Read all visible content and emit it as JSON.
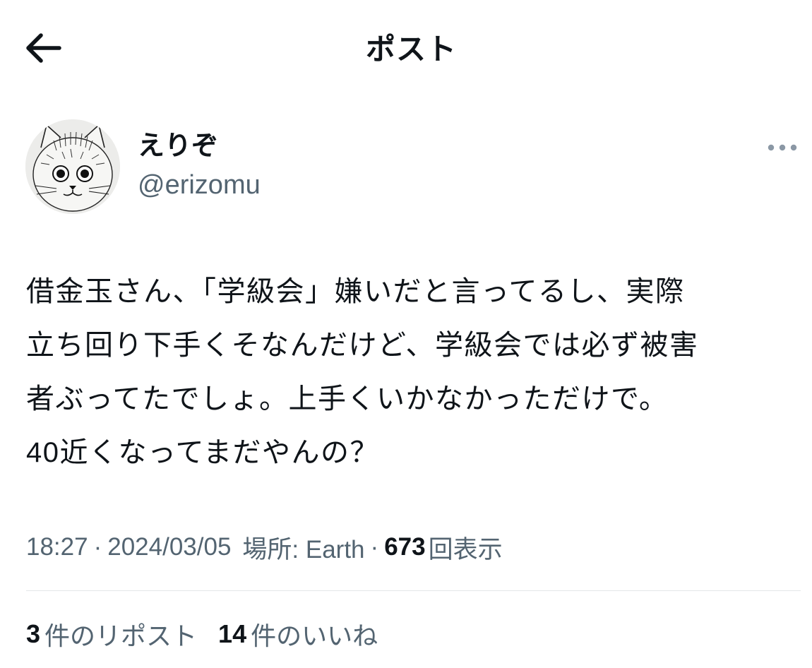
{
  "header": {
    "title": "ポスト",
    "back_icon": "arrow-left-icon"
  },
  "author": {
    "display_name": "えりぞ",
    "handle": "@erizomu",
    "avatar_icon": "cat-drawing-avatar",
    "more_icon": "more-horizontal-icon"
  },
  "post": {
    "lines": [
      "借金玉さん、「学級会」嫌いだと言ってるし、実際",
      "立ち回り下手くそなんだけど、学級会では必ず被害",
      "者ぶってたでしょ。上手くいかなかっただけで。",
      "40近くなってまだやんの？"
    ]
  },
  "meta": {
    "time": "18:27",
    "separator": "·",
    "date": "2024/03/05",
    "location_label": "場所: Earth",
    "views_count": "673",
    "views_label": "回表示"
  },
  "stats": {
    "reposts_count": "3",
    "reposts_label": "件のリポスト",
    "likes_count": "14",
    "likes_label": "件のいいね"
  },
  "colors": {
    "text_primary": "#0f1419",
    "text_secondary": "#536471",
    "divider": "#e3e6e8",
    "background": "#ffffff"
  }
}
